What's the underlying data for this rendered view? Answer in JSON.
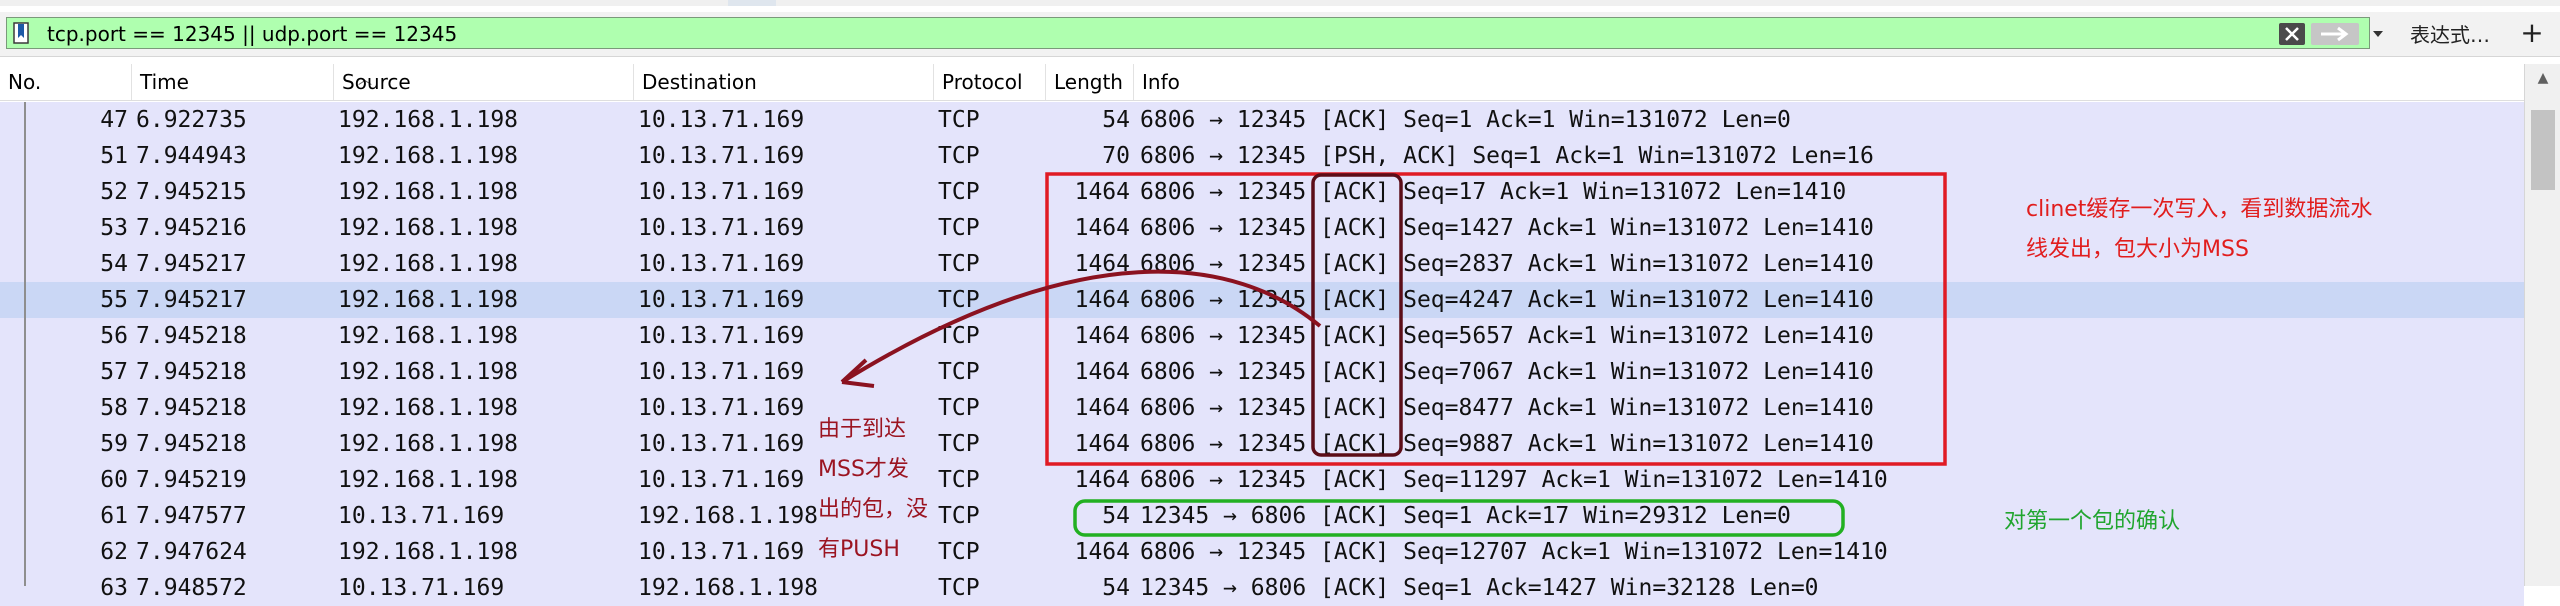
{
  "filter": {
    "expression": "tcp.port == 12345 || udp.port == 12345",
    "expression_button": "表达式…",
    "plus_label": "+"
  },
  "icons": {
    "bookmark": "bookmark-icon",
    "clear": "clear-icon",
    "apply": "apply-arrow-icon",
    "dropdown": "chevron-down-icon"
  },
  "columns": {
    "no": "No.",
    "time": "Time",
    "source": "Source",
    "destination": "Destination",
    "protocol": "Protocol",
    "length": "Length",
    "info": "Info"
  },
  "packets": [
    {
      "no": "47",
      "time": "6.922735",
      "src": "192.168.1.198",
      "dst": "10.13.71.169",
      "proto": "TCP",
      "len": "54",
      "info": "6806 → 12345 [ACK] Seq=1 Ack=1 Win=131072 Len=0"
    },
    {
      "no": "51",
      "time": "7.944943",
      "src": "192.168.1.198",
      "dst": "10.13.71.169",
      "proto": "TCP",
      "len": "70",
      "info": "6806 → 12345 [PSH, ACK] Seq=1 Ack=1 Win=131072 Len=16"
    },
    {
      "no": "52",
      "time": "7.945215",
      "src": "192.168.1.198",
      "dst": "10.13.71.169",
      "proto": "TCP",
      "len": "1464",
      "info": "6806 → 12345 [ACK] Seq=17 Ack=1 Win=131072 Len=1410"
    },
    {
      "no": "53",
      "time": "7.945216",
      "src": "192.168.1.198",
      "dst": "10.13.71.169",
      "proto": "TCP",
      "len": "1464",
      "info": "6806 → 12345 [ACK] Seq=1427 Ack=1 Win=131072 Len=1410"
    },
    {
      "no": "54",
      "time": "7.945217",
      "src": "192.168.1.198",
      "dst": "10.13.71.169",
      "proto": "TCP",
      "len": "1464",
      "info": "6806 → 12345 [ACK] Seq=2837 Ack=1 Win=131072 Len=1410"
    },
    {
      "no": "55",
      "time": "7.945217",
      "src": "192.168.1.198",
      "dst": "10.13.71.169",
      "proto": "TCP",
      "len": "1464",
      "info": "6806 → 12345 [ACK] Seq=4247 Ack=1 Win=131072 Len=1410",
      "selected": true
    },
    {
      "no": "56",
      "time": "7.945218",
      "src": "192.168.1.198",
      "dst": "10.13.71.169",
      "proto": "TCP",
      "len": "1464",
      "info": "6806 → 12345 [ACK] Seq=5657 Ack=1 Win=131072 Len=1410"
    },
    {
      "no": "57",
      "time": "7.945218",
      "src": "192.168.1.198",
      "dst": "10.13.71.169",
      "proto": "TCP",
      "len": "1464",
      "info": "6806 → 12345 [ACK] Seq=7067 Ack=1 Win=131072 Len=1410"
    },
    {
      "no": "58",
      "time": "7.945218",
      "src": "192.168.1.198",
      "dst": "10.13.71.169",
      "proto": "TCP",
      "len": "1464",
      "info": "6806 → 12345 [ACK] Seq=8477 Ack=1 Win=131072 Len=1410"
    },
    {
      "no": "59",
      "time": "7.945218",
      "src": "192.168.1.198",
      "dst": "10.13.71.169",
      "proto": "TCP",
      "len": "1464",
      "info": "6806 → 12345 [ACK] Seq=9887 Ack=1 Win=131072 Len=1410"
    },
    {
      "no": "60",
      "time": "7.945219",
      "src": "192.168.1.198",
      "dst": "10.13.71.169",
      "proto": "TCP",
      "len": "1464",
      "info": "6806 → 12345 [ACK] Seq=11297 Ack=1 Win=131072 Len=1410"
    },
    {
      "no": "61",
      "time": "7.947577",
      "src": "10.13.71.169",
      "dst": "192.168.1.198",
      "proto": "TCP",
      "len": "54",
      "info": "12345 → 6806 [ACK] Seq=1 Ack=17 Win=29312 Len=0"
    },
    {
      "no": "62",
      "time": "7.947624",
      "src": "192.168.1.198",
      "dst": "10.13.71.169",
      "proto": "TCP",
      "len": "1464",
      "info": "6806 → 12345 [ACK] Seq=12707 Ack=1 Win=131072 Len=1410"
    },
    {
      "no": "63",
      "time": "7.948572",
      "src": "10.13.71.169",
      "dst": "192.168.1.198",
      "proto": "TCP",
      "len": "54",
      "info": "12345 → 6806 [ACK] Seq=1 Ack=1427 Win=32128 Len=0"
    }
  ],
  "annotations": {
    "client_note_line1": "clinet缓存一次写入，看到数据流水",
    "client_note_line2": "线发出，包大小为MSS",
    "mss_note_lines": [
      "由于到达",
      "MSS才发",
      "出的包，没",
      "有PUSH"
    ],
    "ack_note": "对第一个包的确认"
  },
  "colors": {
    "filter_valid": "#afffaf",
    "row_tcp": "#e4e4fb",
    "row_selected": "#cad7f5",
    "annotation_red": "#e11d1d",
    "annotation_darkred": "#9b1421",
    "annotation_green": "#21a52f"
  }
}
